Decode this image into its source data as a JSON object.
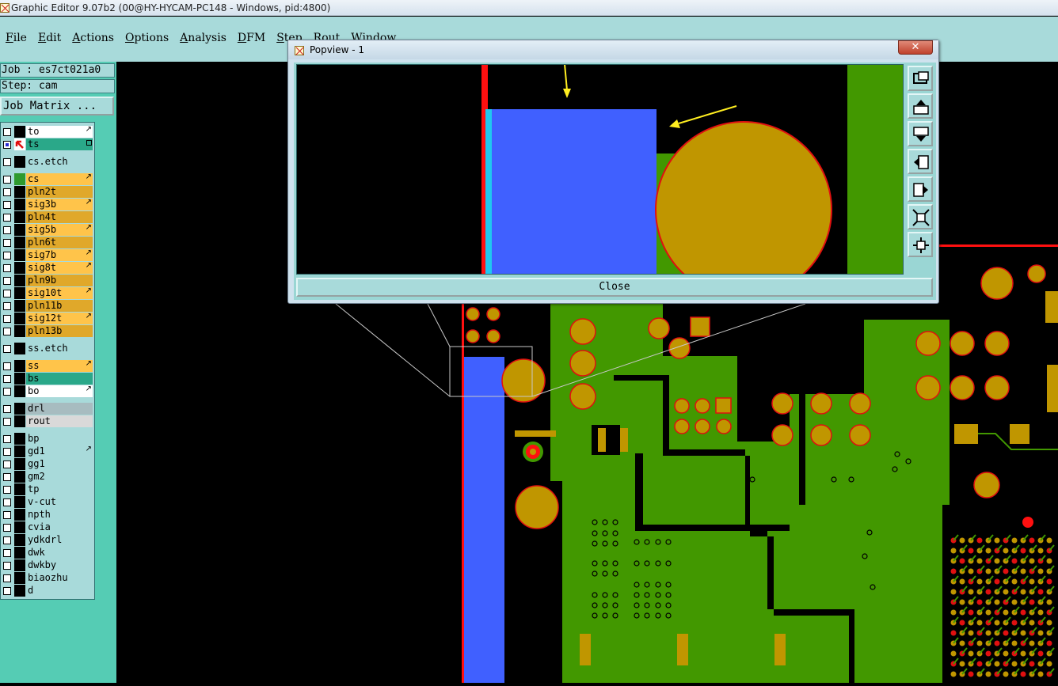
{
  "window": {
    "title": "Graphic Editor 9.07b2 (00@HY-HYCAM-PC148 - Windows, pid:4800)"
  },
  "menubar": {
    "items": [
      {
        "label": "File",
        "u": "F",
        "rest": "ile"
      },
      {
        "label": "Edit",
        "u": "E",
        "rest": "dit"
      },
      {
        "label": "Actions",
        "u": "A",
        "rest": "ctions"
      },
      {
        "label": "Options",
        "u": "O",
        "rest": "ptions"
      },
      {
        "label": "Analysis",
        "u": "A",
        "rest": "nalysis"
      },
      {
        "label": "DFM",
        "u": "D",
        "rest": "FM"
      },
      {
        "label": "Step",
        "u": "S",
        "rest": "tep"
      },
      {
        "label": "Rout",
        "u": "R",
        "rest": "out"
      },
      {
        "label": "Window",
        "u": "W",
        "rest": "indow"
      }
    ]
  },
  "left_panel": {
    "job": "Job : es7ct021a0",
    "step": "Step: cam",
    "job_matrix_button": "Job Matrix ...",
    "layers": [
      {
        "name": "to",
        "color": "#ffffff",
        "mark": "arrow"
      },
      {
        "name": "ts",
        "color": "#2aa889",
        "mark": "box",
        "checked": true,
        "highlight": true
      },
      {
        "name": "cs.etch",
        "color": "#a8dada",
        "mark": ""
      },
      {
        "name": "cs",
        "color": "#ffc44a",
        "mark": "arrow",
        "swatch": "#2e9a2e"
      },
      {
        "name": "pln2t",
        "color": "#e0a82a",
        "mark": ""
      },
      {
        "name": "sig3b",
        "color": "#ffc44a",
        "mark": "arrow"
      },
      {
        "name": "pln4t",
        "color": "#e0a82a",
        "mark": ""
      },
      {
        "name": "sig5b",
        "color": "#ffc44a",
        "mark": "arrow"
      },
      {
        "name": "pln6t",
        "color": "#e0a82a",
        "mark": ""
      },
      {
        "name": "sig7b",
        "color": "#ffc44a",
        "mark": "arrow"
      },
      {
        "name": "sig8t",
        "color": "#ffc44a",
        "mark": "arrow"
      },
      {
        "name": "pln9b",
        "color": "#e0a82a",
        "mark": ""
      },
      {
        "name": "sig10t",
        "color": "#ffc44a",
        "mark": "arrow"
      },
      {
        "name": "pln11b",
        "color": "#e0a82a",
        "mark": ""
      },
      {
        "name": "sig12t",
        "color": "#ffc44a",
        "mark": "arrow"
      },
      {
        "name": "pln13b",
        "color": "#e0a82a",
        "mark": ""
      },
      {
        "name": "ss.etch",
        "color": "#a8dada",
        "mark": ""
      },
      {
        "name": "ss",
        "color": "#ffc44a",
        "mark": "arrow"
      },
      {
        "name": "bs",
        "color": "#2aa889",
        "mark": ""
      },
      {
        "name": "bo",
        "color": "#ffffff",
        "mark": "arrow"
      },
      {
        "name": "drl",
        "color": "#a7bcc0",
        "mark": ""
      },
      {
        "name": "rout",
        "color": "#d9d9d9",
        "mark": ""
      },
      {
        "name": "bp",
        "color": "#a8dada",
        "mark": ""
      },
      {
        "name": "gd1",
        "color": "#a8dada",
        "mark": "arrow"
      },
      {
        "name": "gg1",
        "color": "#a8dada",
        "mark": ""
      },
      {
        "name": "gm2",
        "color": "#a8dada",
        "mark": ""
      },
      {
        "name": "tp",
        "color": "#a8dada",
        "mark": ""
      },
      {
        "name": "v-cut",
        "color": "#a8dada",
        "mark": ""
      },
      {
        "name": "npth",
        "color": "#a8dada",
        "mark": ""
      },
      {
        "name": "cvia",
        "color": "#a8dada",
        "mark": ""
      },
      {
        "name": "ydkdrl",
        "color": "#a8dada",
        "mark": ""
      },
      {
        "name": "dwk",
        "color": "#a8dada",
        "mark": ""
      },
      {
        "name": "dwkby",
        "color": "#a8dada",
        "mark": ""
      },
      {
        "name": "biaozhu",
        "color": "#a8dada",
        "mark": ""
      },
      {
        "name": "d",
        "color": "#a8dada",
        "mark": ""
      }
    ]
  },
  "popview": {
    "title": "Popview - 1",
    "close_label": "Close",
    "tools": [
      "zoom-window-icon",
      "pan-up-icon",
      "pan-down-icon",
      "pan-left-icon",
      "pan-right-icon",
      "zoom-in-icon",
      "zoom-out-icon"
    ]
  },
  "colors": {
    "copper": "#429800",
    "pad": "#c09600",
    "pad_outline": "#e01010",
    "blue_feature": "#4060ff",
    "red_line": "#ff1010",
    "annotation_arrow": "#ffee20"
  }
}
